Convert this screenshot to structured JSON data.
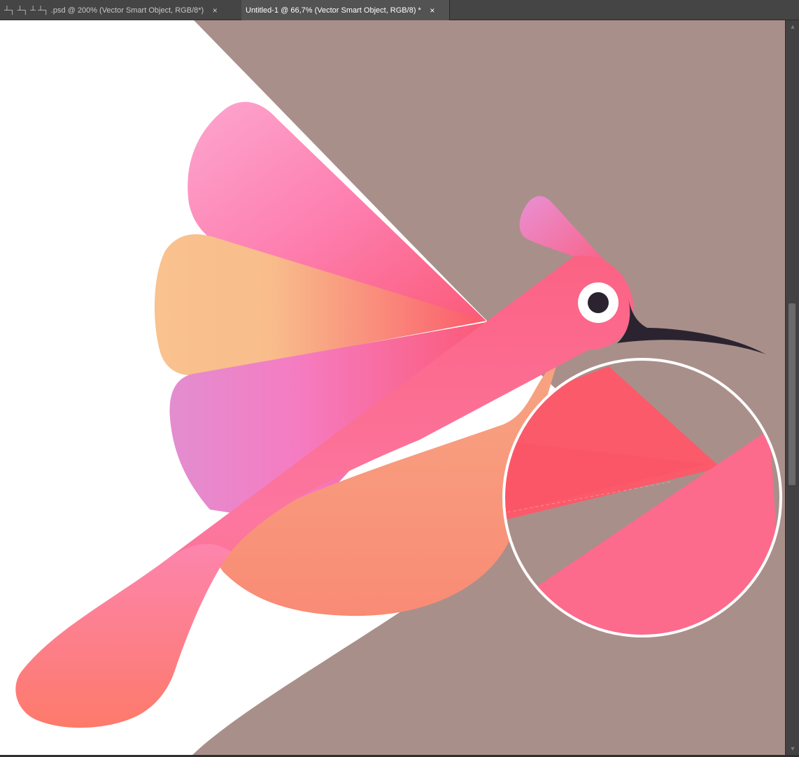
{
  "tabs": [
    {
      "label": "┴┐ ┴┐ ┴  ┴┐ .psd @ 200% (Vector Smart Object, RGB/8*)",
      "close": "×"
    },
    {
      "label": "Untitled-1 @ 66,7% (Vector Smart Object, RGB/8) *",
      "close": "×"
    }
  ],
  "canvas": {
    "background_colors": {
      "white": "#ffffff",
      "taupe": "#a98f8a"
    },
    "artwork": "hummingbird-illustration",
    "palette": {
      "body_pink": "#fb6f98",
      "feather_pink": "#fd7fb3",
      "feather_peach": "#f8c08d",
      "feather_violet": "#e483cf",
      "belly_orange": "#f89b7a",
      "beak": "#2b2430",
      "eye_ring": "#ffffff",
      "zoom_circle_stroke": "#ffffff"
    }
  },
  "scrollbar": {
    "up_icon": "▲",
    "down_icon": "▼"
  }
}
